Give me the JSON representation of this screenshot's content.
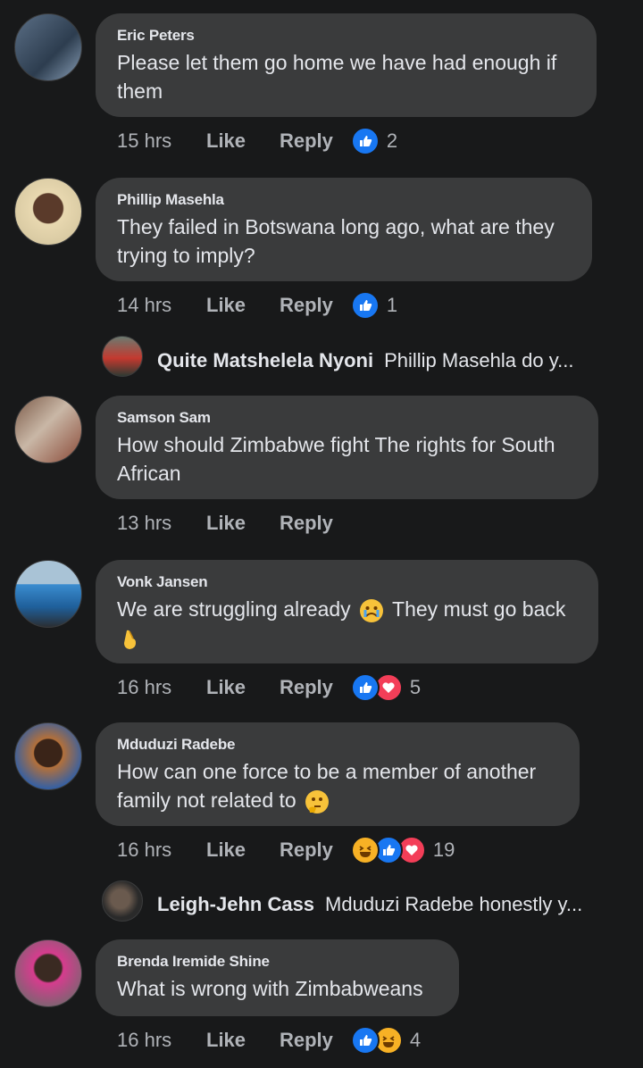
{
  "comments": [
    {
      "name": "Eric Peters",
      "text": "Please let them go home we have had enough if them",
      "time": "15 hrs",
      "like": "Like",
      "reply": "Reply",
      "count": "2"
    },
    {
      "name": "Phillip Masehla",
      "text": "They failed in Botswana long ago, what are they trying to imply?",
      "time": "14 hrs",
      "like": "Like",
      "reply": "Reply",
      "count": "1",
      "reply_preview": {
        "name": "Quite Matshelela Nyoni",
        "text": "Phillip Masehla do y..."
      }
    },
    {
      "name": "Samson Sam",
      "text": "How should Zimbabwe fight The rights for South African",
      "time": "13 hrs",
      "like": "Like",
      "reply": "Reply"
    },
    {
      "name": "Vonk Jansen",
      "text_a": "We are struggling already",
      "text_b": "They must go back",
      "time": "16 hrs",
      "like": "Like",
      "reply": "Reply",
      "count": "5"
    },
    {
      "name": "Mduduzi Radebe",
      "text": "How can one force to be a member of another family not related to",
      "time": "16 hrs",
      "like": "Like",
      "reply": "Reply",
      "count": "19",
      "reply_preview": {
        "name": "Leigh-Jehn Cass",
        "text": "Mduduzi Radebe honestly y..."
      }
    },
    {
      "name": "Brenda Iremide Shine",
      "text": "What is wrong with Zimbabweans",
      "time": "16 hrs",
      "like": "Like",
      "reply": "Reply",
      "count": "4"
    }
  ],
  "icons": {
    "like": "thumbs-up-icon",
    "love": "heart-icon",
    "haha": "laughing-face-icon"
  },
  "colors": {
    "background": "#18191a",
    "bubble": "#3a3b3c",
    "like": "#1877f2",
    "love": "#f33e58"
  }
}
